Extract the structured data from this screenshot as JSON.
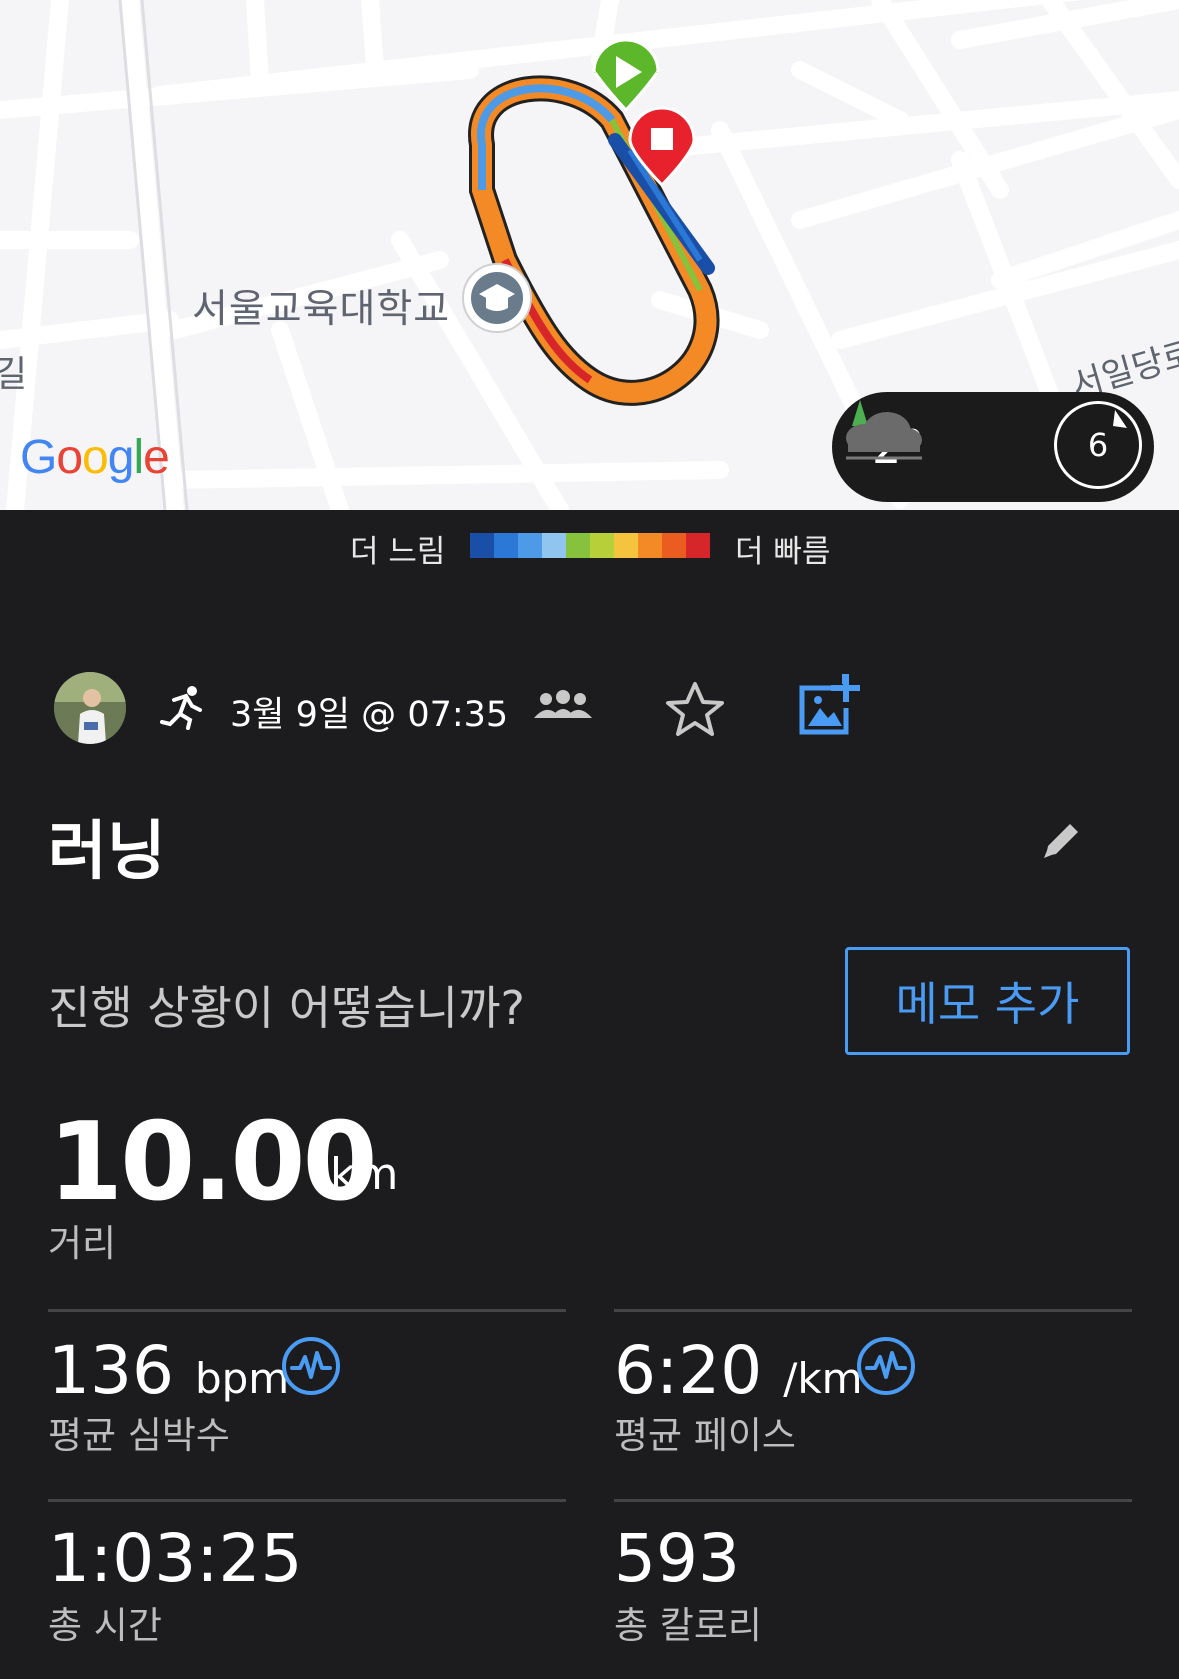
{
  "map": {
    "place_label": "서울교육대학교",
    "road_label_left": "길",
    "road_label_right": "서일당로",
    "google_logo": "Google",
    "weather": {
      "temperature": "2°",
      "icon": "cloudy-tree-icon",
      "wind_speed": "6"
    }
  },
  "legend": {
    "slow_label": "더 느림",
    "fast_label": "더 빠름",
    "colors": [
      "#1a4fa8",
      "#2b78d6",
      "#4d9be6",
      "#8fc5ee",
      "#86c23c",
      "#b7cf39",
      "#f4c43f",
      "#f38a26",
      "#ea5c1f",
      "#d7262a"
    ]
  },
  "activity": {
    "date": "3월 9일 @ 07:35",
    "title": "러닝",
    "prompt": "진행 상황이 어떻습니까?",
    "memo_button": "메모 추가"
  },
  "stats": {
    "distance": {
      "value": "10.00",
      "unit": "km",
      "label": "거리"
    },
    "heart_rate": {
      "value": "136",
      "unit": "bpm",
      "label": "평균 심박수"
    },
    "pace": {
      "value": "6:20",
      "unit": "/km",
      "label": "평균 페이스"
    },
    "time": {
      "value": "1:03:25",
      "label": "총 시간"
    },
    "calories": {
      "value": "593",
      "label": "총 칼로리"
    }
  },
  "colors": {
    "accent": "#4a9bf3",
    "background": "#1c1c1e",
    "start_pin": "#5cb82a",
    "stop_pin": "#e8222c"
  }
}
